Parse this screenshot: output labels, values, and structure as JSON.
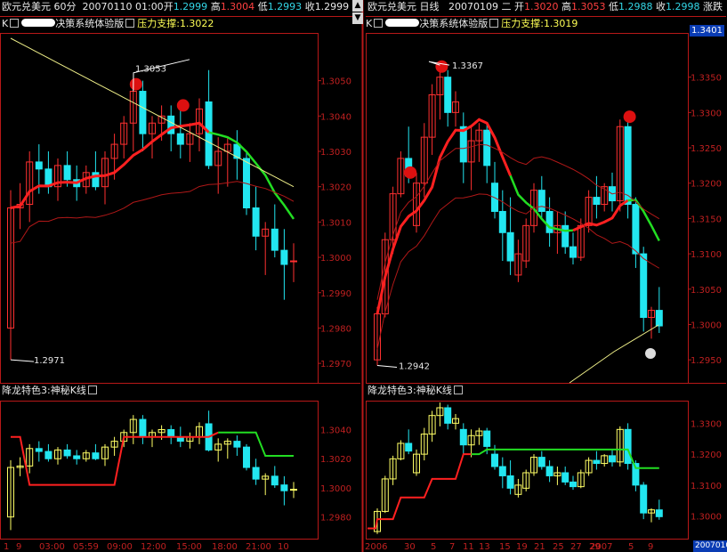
{
  "left": {
    "info": {
      "symbol": "欧元兑美元",
      "period": "60分",
      "datetime": "20070110 01:00",
      "open_label": "开",
      "open": "1.2999",
      "high_label": "高",
      "high": "1.3004",
      "low_label": "低",
      "low": "1.2993",
      "close_label": "收",
      "close": "1.2999"
    },
    "main_title": "K",
    "indicator_name": "决策系统体验版",
    "sr_label": "压力支撑:",
    "sr_value": "1.3022",
    "price_ticks": [
      "1.3050",
      "1.3040",
      "1.3030",
      "1.3020",
      "1.3010",
      "1.3000",
      "1.2990",
      "1.2980",
      "1.2970"
    ],
    "annot_high": "1.3053",
    "annot_low": "1.2971",
    "sub_title": "降龙特色3:神秘K线",
    "sub_ticks": [
      "1.3040",
      "1.3020",
      "1.3000",
      "1.2980"
    ],
    "x_ticks": [
      "1",
      "9",
      "03:00",
      "05:59",
      "09:00",
      "12:00",
      "15:00",
      "18:00",
      "21:00",
      "10"
    ]
  },
  "right": {
    "info": {
      "symbol": "欧元兑美元",
      "period": "日线",
      "date": "20070109",
      "weekday": "二",
      "open_label": "开",
      "open": "1.3020",
      "high_label": "高",
      "high": "1.3053",
      "low_label": "低",
      "low": "1.2988",
      "close_label": "收",
      "close": "1.2998",
      "extra": "涨跌"
    },
    "main_title": "K",
    "indicator_name": "决策系统体验版",
    "sr_label": "压力支撑:",
    "sr_value": "1.3019",
    "price_highlight": "1.3401",
    "price_ticks": [
      "1.3350",
      "1.3300",
      "1.3250",
      "1.3200",
      "1.3150",
      "1.3100",
      "1.3050",
      "1.3000",
      "1.2950"
    ],
    "annot_high": "1.3367",
    "annot_low": "1.2942",
    "sub_title": "降龙特色3:神秘K线",
    "sub_ticks": [
      "1.3300",
      "1.3200",
      "1.3100",
      "1.3000"
    ],
    "x_ticks": [
      "2006",
      "30",
      "5",
      "7",
      "11",
      "13",
      "15",
      "19",
      "21",
      "25",
      "27",
      "29",
      "2007",
      "5",
      "9"
    ],
    "x_highlight": "20070109"
  },
  "colors": {
    "up": "#ff3030",
    "down": "#22e6f0",
    "frame": "#b81818",
    "axis_text": "#c02020",
    "ma_red": "#ff2020",
    "ma_green": "#22dd22",
    "ma_yellow": "#eeee88",
    "ma_dark": "#b01818",
    "marker": "#dd1010"
  },
  "chart_data": [
    {
      "type": "candlestick",
      "title": "欧元兑美元 60分",
      "ylim": [
        1.2966,
        1.3062
      ],
      "ohlc": [
        [
          1.298,
          1.3019,
          1.2971,
          1.3014
        ],
        [
          1.3014,
          1.3021,
          1.3008,
          1.3015
        ],
        [
          1.3015,
          1.303,
          1.301,
          1.3027
        ],
        [
          1.3027,
          1.3032,
          1.3018,
          1.3025
        ],
        [
          1.3025,
          1.303,
          1.3018,
          1.302
        ],
        [
          1.302,
          1.3028,
          1.3016,
          1.3026
        ],
        [
          1.3026,
          1.303,
          1.302,
          1.3022
        ],
        [
          1.3022,
          1.3026,
          1.3016,
          1.302
        ],
        [
          1.302,
          1.3026,
          1.3018,
          1.3024
        ],
        [
          1.3024,
          1.303,
          1.3019,
          1.302
        ],
        [
          1.302,
          1.303,
          1.3015,
          1.3028
        ],
        [
          1.3028,
          1.3035,
          1.3022,
          1.3032
        ],
        [
          1.3032,
          1.304,
          1.3028,
          1.3038
        ],
        [
          1.3038,
          1.305,
          1.303,
          1.3047
        ],
        [
          1.3047,
          1.305,
          1.303,
          1.3035
        ],
        [
          1.3035,
          1.304,
          1.3028,
          1.3038
        ],
        [
          1.3038,
          1.3043,
          1.3033,
          1.304
        ],
        [
          1.304,
          1.3043,
          1.303,
          1.3035
        ],
        [
          1.3035,
          1.3042,
          1.3028,
          1.3032
        ],
        [
          1.3032,
          1.3038,
          1.3027,
          1.3035
        ],
        [
          1.3035,
          1.3045,
          1.303,
          1.3042
        ],
        [
          1.3044,
          1.3053,
          1.3025,
          1.3026
        ],
        [
          1.3026,
          1.3034,
          1.3018,
          1.303
        ],
        [
          1.303,
          1.3034,
          1.302,
          1.3032
        ],
        [
          1.3032,
          1.3036,
          1.3022,
          1.3028
        ],
        [
          1.3028,
          1.303,
          1.3012,
          1.3014
        ],
        [
          1.3014,
          1.302,
          1.3002,
          1.3006
        ],
        [
          1.3006,
          1.301,
          1.2995,
          1.3008
        ],
        [
          1.3008,
          1.3015,
          1.3,
          1.3002
        ],
        [
          1.3002,
          1.3008,
          1.2988,
          1.2998
        ],
        [
          1.2999,
          1.3004,
          1.2993,
          1.2999
        ]
      ]
    },
    {
      "type": "candlestick",
      "title": "欧元兑美元 日线",
      "ylim": [
        1.2925,
        1.3405
      ],
      "ohlc": [
        [
          1.295,
          1.3025,
          1.2942,
          1.3015
        ],
        [
          1.3015,
          1.313,
          1.301,
          1.312
        ],
        [
          1.312,
          1.3195,
          1.31,
          1.3185
        ],
        [
          1.3185,
          1.3245,
          1.318,
          1.3235
        ],
        [
          1.3235,
          1.328,
          1.32,
          1.321
        ],
        [
          1.314,
          1.3215,
          1.313,
          1.32
        ],
        [
          1.32,
          1.3285,
          1.318,
          1.3265
        ],
        [
          1.3265,
          1.334,
          1.324,
          1.3325
        ],
        [
          1.3325,
          1.3367,
          1.329,
          1.335
        ],
        [
          1.335,
          1.336,
          1.328,
          1.33
        ],
        [
          1.33,
          1.333,
          1.328,
          1.3315
        ],
        [
          1.328,
          1.33,
          1.32,
          1.323
        ],
        [
          1.323,
          1.328,
          1.319,
          1.326
        ],
        [
          1.326,
          1.3285,
          1.323,
          1.3275
        ],
        [
          1.3275,
          1.3285,
          1.32,
          1.3225
        ],
        [
          1.32,
          1.323,
          1.315,
          1.316
        ],
        [
          1.316,
          1.319,
          1.309,
          1.313
        ],
        [
          1.313,
          1.318,
          1.307,
          1.309
        ],
        [
          1.307,
          1.312,
          1.306,
          1.31
        ],
        [
          1.309,
          1.315,
          1.308,
          1.314
        ],
        [
          1.314,
          1.32,
          1.313,
          1.319
        ],
        [
          1.319,
          1.321,
          1.315,
          1.316
        ],
        [
          1.316,
          1.318,
          1.311,
          1.313
        ],
        [
          1.313,
          1.316,
          1.31,
          1.314
        ],
        [
          1.314,
          1.316,
          1.31,
          1.311
        ],
        [
          1.311,
          1.313,
          1.3085,
          1.3095
        ],
        [
          1.3095,
          1.315,
          1.309,
          1.314
        ],
        [
          1.314,
          1.319,
          1.313,
          1.318
        ],
        [
          1.318,
          1.321,
          1.315,
          1.317
        ],
        [
          1.317,
          1.32,
          1.316,
          1.3195
        ],
        [
          1.3195,
          1.3215,
          1.316,
          1.3175
        ],
        [
          1.3175,
          1.329,
          1.316,
          1.328
        ],
        [
          1.328,
          1.33,
          1.315,
          1.317
        ],
        [
          1.317,
          1.318,
          1.308,
          1.31
        ],
        [
          1.31,
          1.311,
          1.299,
          1.301
        ],
        [
          1.301,
          1.3025,
          1.298,
          1.302
        ],
        [
          1.302,
          1.3053,
          1.2988,
          1.2998
        ]
      ]
    }
  ]
}
